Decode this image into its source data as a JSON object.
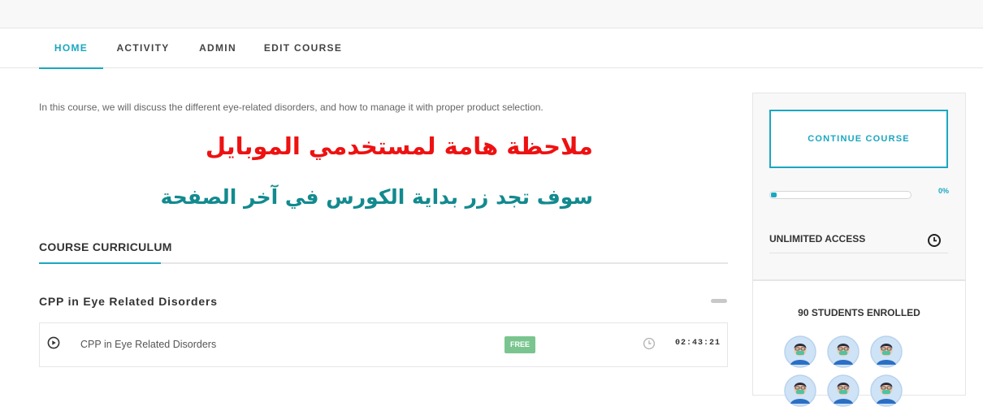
{
  "nav": {
    "tabs": [
      {
        "label": "HOME",
        "active": true
      },
      {
        "label": "ACTIVITY",
        "active": false
      },
      {
        "label": "ADMIN",
        "active": false
      },
      {
        "label": "EDIT COURSE",
        "active": false
      }
    ]
  },
  "course": {
    "description": "In this course, we will discuss the different eye-related disorders, and how to manage it with proper product selection.",
    "notice_title": "ملاحظة هامة لمستخدمي الموبايل",
    "notice_body": "سوف تجد زر بداية الكورس في  آخر الصفحة"
  },
  "curriculum": {
    "heading": "COURSE CURRICULUM",
    "section_title": "CPP in Eye Related Disorders",
    "units": [
      {
        "title": "CPP in Eye Related Disorders",
        "badge": "FREE",
        "duration": "02:43:21",
        "icon": "play-icon"
      }
    ]
  },
  "sidebar": {
    "continue_label": "CONTINUE COURSE",
    "progress_text": "0%",
    "progress_value": 0,
    "access_label": "UNLIMITED ACCESS",
    "access_icon": "clock-icon",
    "students_label": "90 STUDENTS ENROLLED"
  },
  "colors": {
    "accent": "#1aa7c1",
    "notice_red": "#ee1111",
    "notice_teal": "#128a8e",
    "badge_green": "#7ac58f"
  }
}
